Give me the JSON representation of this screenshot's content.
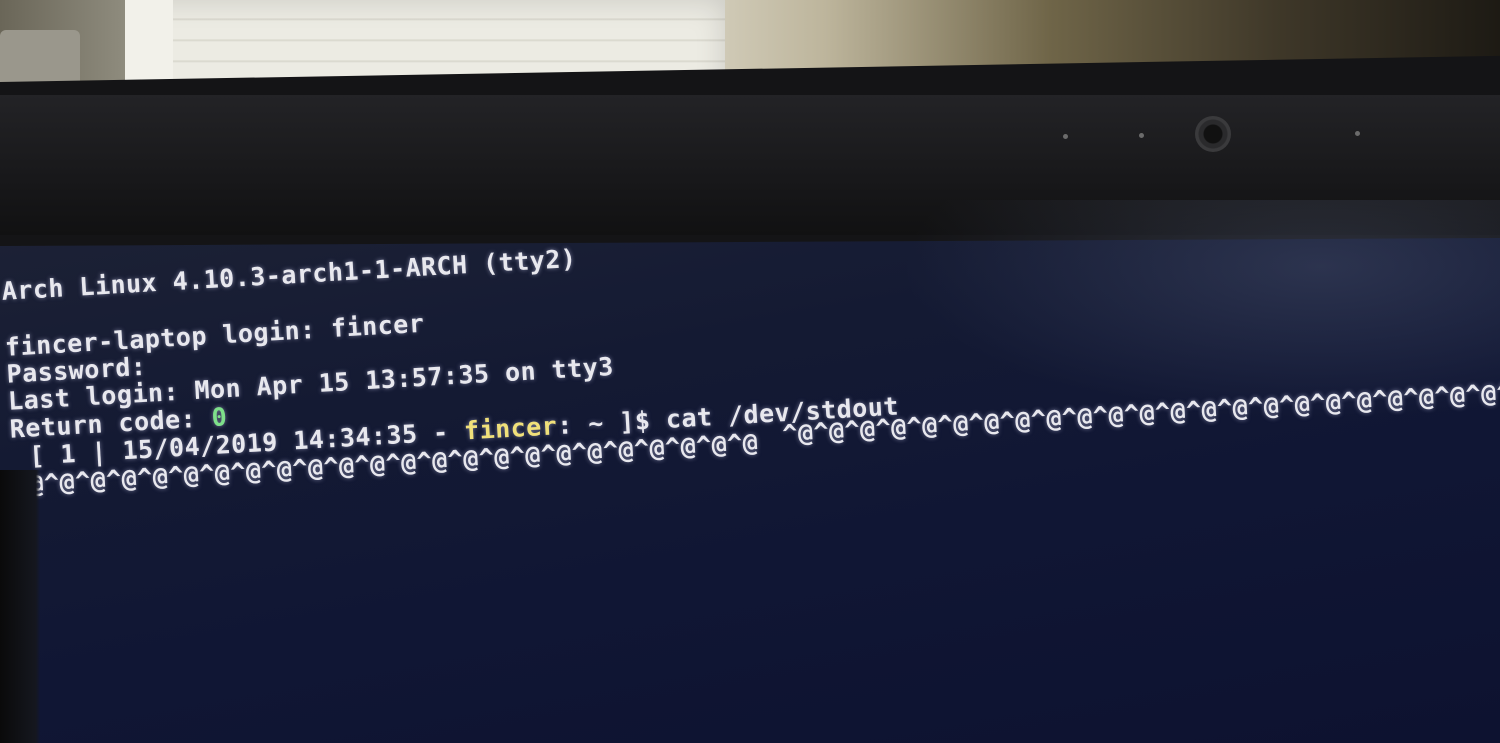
{
  "terminal": {
    "banner": "Arch Linux 4.10.3-arch1-1-ARCH (tty2)",
    "login_line": "fincer-laptop login: fincer",
    "password_line": "Password:",
    "last_login": "Last login: Mon Apr 15 13:57:35 on tty3",
    "return_code_label": "Return code: ",
    "return_code_value": "0",
    "prompt_prefix": "[ 1 | 15/04/2019 14:34:35 - ",
    "prompt_user": "fincer",
    "prompt_suffix": ": ~ ]$ ",
    "command": "cat /dev/stdout",
    "output_line_1": "^@^@^@^@^@^@^@^@^@^@^@^@^@^@^@^@^@^@^@^@^@^@^@^@^@^@^@^@^@^@^@^@^@^@^@^@^@^@^@^@^@^@^@^@^@^@^@^@^@^@^@^@^@^@^@^@^@^@^@^@",
    "output_line_2": "^@^@^@^@^@^@^@^@^@^@^@^@^@^@^@^@^@^@^@^@^@^@^@^@"
  },
  "colors": {
    "screen_bg": "#101634",
    "text": "#e8e8ee",
    "return_code": "#7ee08a",
    "prompt_user": "#f0e07a"
  }
}
